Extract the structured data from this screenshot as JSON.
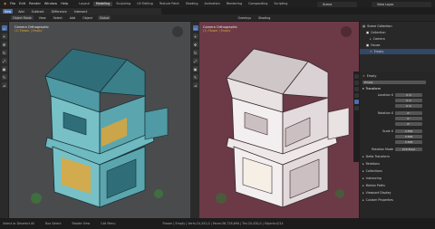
{
  "menus": [
    "File",
    "Edit",
    "Render",
    "Window",
    "Help"
  ],
  "workspace_tabs": [
    "Layout",
    "Modeling",
    "Sculpting",
    "UV Editing",
    "Texture Paint",
    "Shading",
    "Animation",
    "Rendering",
    "Compositing",
    "Scripting"
  ],
  "active_workspace": "Modeling",
  "scene": {
    "name": "Scene",
    "view_layer": "View Layer"
  },
  "mode_buttons": [
    "New",
    "Add",
    "Subtract",
    "Difference",
    "Intersect"
  ],
  "object_mode_label": "Object Mode",
  "header_menus": [
    "View",
    "Select",
    "Add",
    "Object"
  ],
  "transform_label": "Global",
  "viewport_left": {
    "title": "Camera Orthographic",
    "subtitle": "(1) Flower | Empty"
  },
  "viewport_right": {
    "title": "Camera Orthographic",
    "subtitle": "(1) Flower | Empty",
    "overlay_label": "Overlays",
    "shading_label": "Shading"
  },
  "outliner": {
    "title": "Scene Collection",
    "items": [
      {
        "name": "Collection",
        "type": "collection"
      },
      {
        "name": "Camera",
        "type": "camera"
      },
      {
        "name": "House",
        "type": "collection"
      },
      {
        "name": "Empty",
        "type": "empty"
      }
    ]
  },
  "properties": {
    "object_name": "Empty",
    "tab_name": "Empty",
    "transform_header": "Transform",
    "location_label": "Location X",
    "location": [
      "0 m",
      "0 m",
      "0 m"
    ],
    "rotation_label": "Rotation X",
    "rotation": [
      "0°",
      "0°",
      "0°"
    ],
    "scale_label": "Scale X",
    "scale": [
      "3.558",
      "3.558",
      "3.558"
    ],
    "rotation_mode_label": "Rotation Mode",
    "rotation_mode": "XYZ Euler",
    "sections": [
      "Delta Transform",
      "Relations",
      "Collections",
      "Instancing",
      "Motion Paths",
      "Viewport Display",
      "Custom Properties"
    ]
  },
  "status": {
    "left": "Select or Deselect All",
    "box": "Box Select",
    "rotate": "Rotate View",
    "call_menu": "Call Menu",
    "right": "Flower | Empty | Verts:24,452,0 | Faces:56,728,690 | Tris:20,430,0 | Objects:0/14"
  },
  "colors": {
    "accent": "#4c6ea8",
    "header": "#202020",
    "vp_left_bg": "#4a4b4d",
    "vp_right_bg": "#6b3a46"
  }
}
